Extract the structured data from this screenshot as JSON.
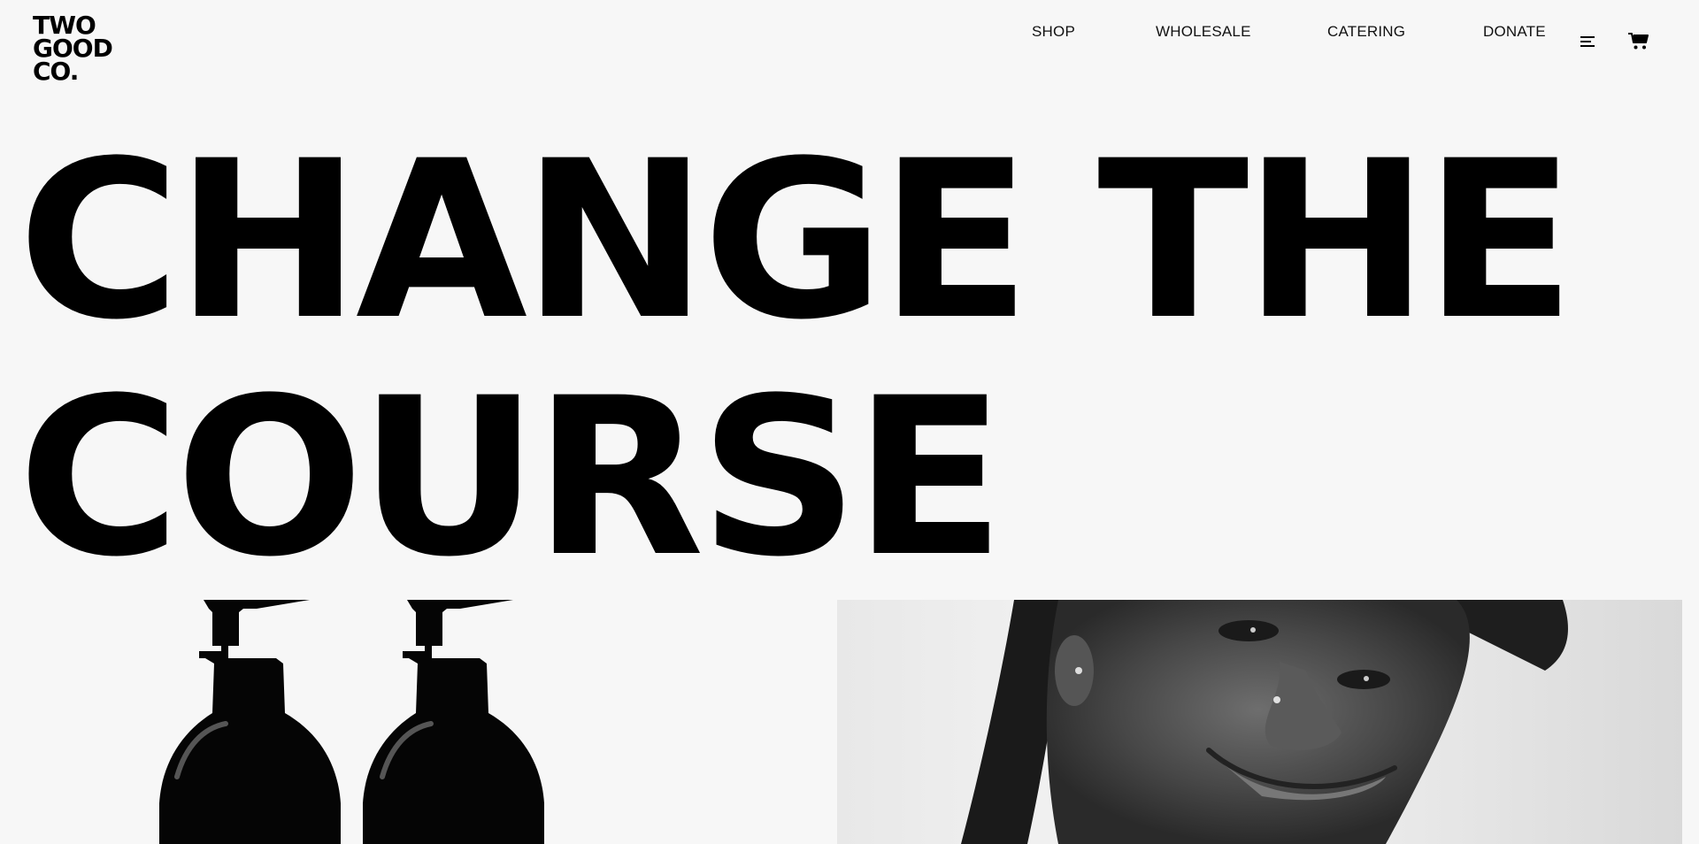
{
  "brand": {
    "logo_line1": "TWO",
    "logo_line2": "GOOD",
    "logo_line3": "CO."
  },
  "nav": {
    "items": [
      {
        "label": "SHOP"
      },
      {
        "label": "WHOLESALE"
      },
      {
        "label": "CATERING"
      },
      {
        "label": "DONATE"
      }
    ],
    "menu_icon": "hamburger-icon",
    "cart_icon": "cart-icon"
  },
  "hero": {
    "headline_line1": "CHANGE THE",
    "headline_line2": "COURSE"
  },
  "images": {
    "left": "product-bottles",
    "right": "portrait-photo"
  },
  "colors": {
    "background": "#f7f7f7",
    "text": "#000000"
  }
}
